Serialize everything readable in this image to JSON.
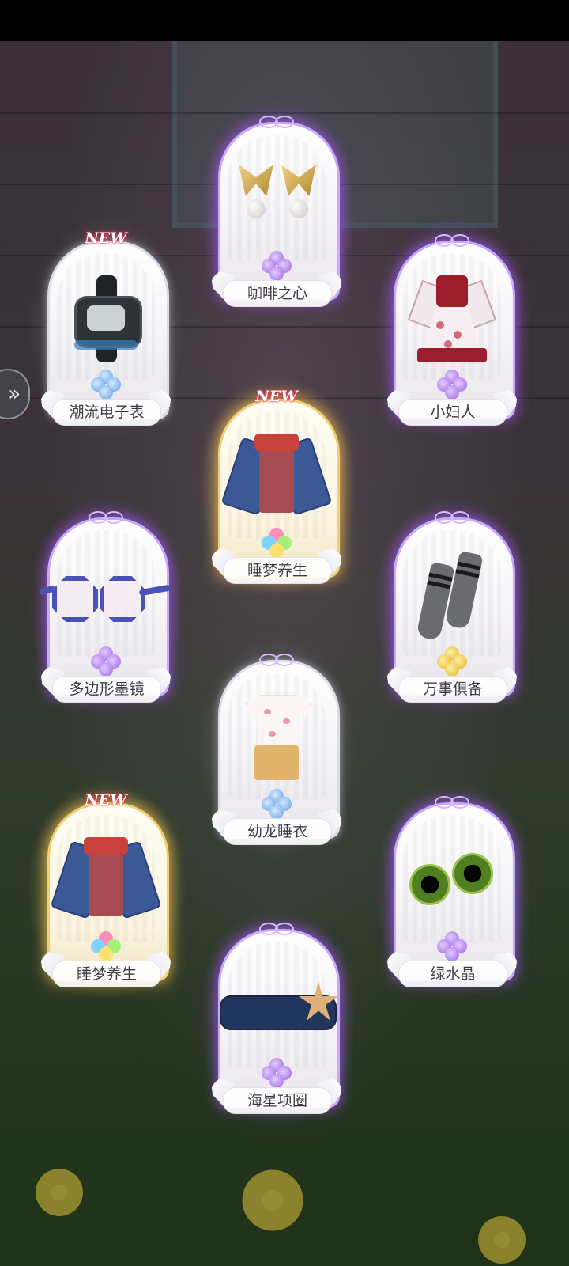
{
  "scene": {
    "new_badge": "NEW",
    "side_nav_glyph": "»"
  },
  "cards": {
    "watch": {
      "name": "潮流电子表",
      "new": true,
      "rarity": "blue"
    },
    "coffee_heart": {
      "name": "咖啡之心",
      "new": false,
      "rarity": "purple"
    },
    "little_women": {
      "name": "小妇人",
      "new": false,
      "rarity": "purple"
    },
    "sleep_1": {
      "name": "睡梦养生",
      "new": true,
      "rarity": "rainbow"
    },
    "polygon_glasses": {
      "name": "多边形墨镜",
      "new": false,
      "rarity": "purple"
    },
    "all_ready": {
      "name": "万事俱备",
      "new": false,
      "rarity": "gold"
    },
    "dragon_pajamas": {
      "name": "幼龙睡衣",
      "new": false,
      "rarity": "blue"
    },
    "sleep_2": {
      "name": "睡梦养生",
      "new": true,
      "rarity": "rainbow"
    },
    "green_crystal": {
      "name": "绿水晶",
      "new": false,
      "rarity": "purple"
    },
    "starfish_collar": {
      "name": "海星项圈",
      "new": false,
      "rarity": "purple"
    }
  },
  "colors": {
    "purple_glow": "#aa5aff",
    "gold_glow": "#ffc850",
    "label_text": "#3e3a44"
  }
}
